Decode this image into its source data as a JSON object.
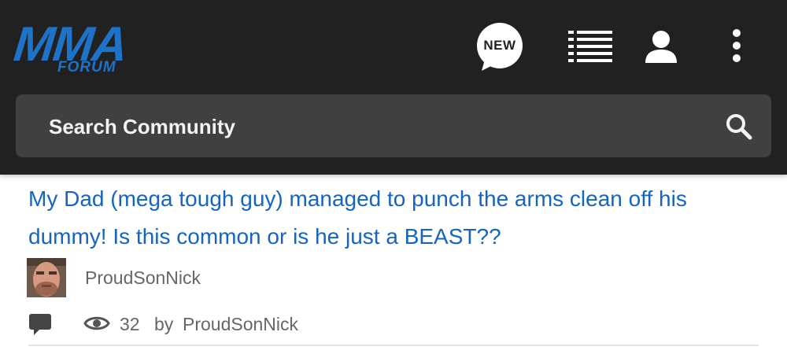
{
  "header": {
    "logo": {
      "main": "MMA",
      "sub": "FORUM"
    },
    "new_label": "NEW",
    "icons": [
      "new-bubble-icon",
      "list-icon",
      "user-icon",
      "more-vertical-icon"
    ],
    "colors": {
      "background": "#212121",
      "logo": "#1e73c8"
    }
  },
  "search": {
    "placeholder": "Search Community",
    "icon": "search-icon",
    "background": "#404040"
  },
  "thread": {
    "title": "My Dad (mega tough guy) managed to punch the arms clean off his dummy! Is this common or is he just a BEAST??",
    "author": "ProudSonNick",
    "views": "32",
    "by_label": "by",
    "by_author": "ProudSonNick",
    "icons": [
      "comment-icon",
      "eye-icon"
    ],
    "title_color": "#1565c0"
  }
}
